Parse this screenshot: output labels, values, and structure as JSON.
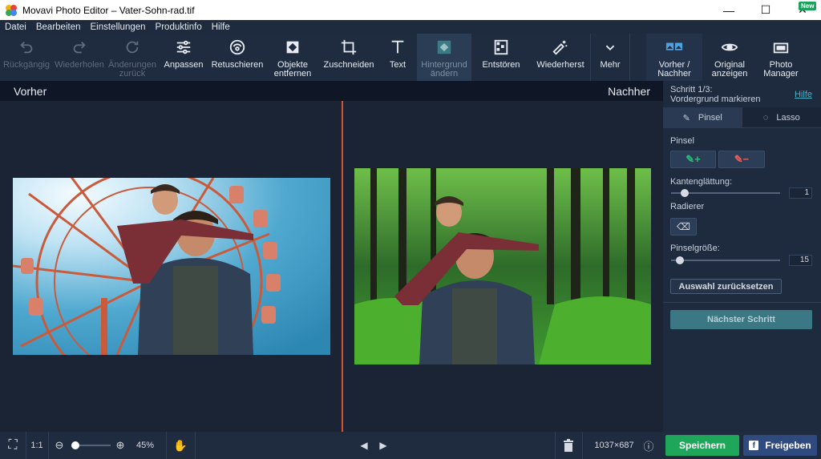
{
  "window": {
    "title": "Movavi Photo Editor – Vater-Sohn-rad.tif",
    "minimize": "—",
    "maximize": "☐",
    "close": "✕"
  },
  "menu": [
    "Datei",
    "Bearbeiten",
    "Einstellungen",
    "Produktinfo",
    "Hilfe"
  ],
  "toolbar": {
    "undo": "Rückgängig",
    "redo": "Wiederholen",
    "reset_line1": "Änderungen",
    "reset_line2": "zurück",
    "adjust": "Anpassen",
    "retouch": "Retuschieren",
    "remove_line1": "Objekte",
    "remove_line2": "entfernen",
    "crop": "Zuschneiden",
    "text": "Text",
    "bg_line1": "Hintergrund",
    "bg_line2": "ändern",
    "denoise": "Entstören",
    "restore": "Wiederherst",
    "more": "Mehr",
    "beforeafter_line1": "Vorher /",
    "beforeafter_line2": "Nachher",
    "original_line1": "Original",
    "original_line2": "anzeigen",
    "pm_line1": "Photo",
    "pm_line2": "Manager",
    "new_badge": "New"
  },
  "compare": {
    "before": "Vorher",
    "after": "Nachher"
  },
  "panel": {
    "step_line1": "Schritt 1/3:",
    "step_line2": "Vordergrund markieren",
    "help": "Hilfe",
    "tab_brush": "Pinsel",
    "tab_lasso": "Lasso",
    "brush_label": "Pinsel",
    "smoothing_label": "Kantenglättung:",
    "smoothing_value": "1",
    "eraser_label": "Radierer",
    "brushsize_label": "Pinselgröße:",
    "brushsize_value": "15",
    "reset_selection": "Auswahl zurücksetzen",
    "next_step": "Nächster Schritt"
  },
  "status": {
    "fit": "⛶",
    "one_to_one": "1:1",
    "zoom": "45%",
    "dimensions": "1037×687",
    "save": "Speichern",
    "share": "Freigeben"
  },
  "colors": {
    "accent_save": "#1ea65a",
    "accent_share": "#2e4a7e",
    "divider": "#d6532d",
    "next_step": "#3b7884"
  }
}
